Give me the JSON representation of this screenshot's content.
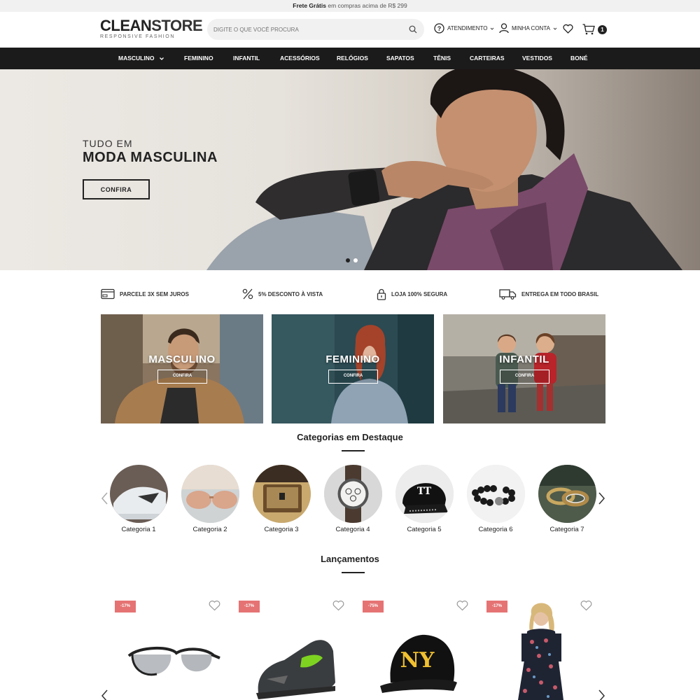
{
  "topbar": {
    "bold": "Frete Grátis",
    "rest": " em compras acima de R$ 299"
  },
  "header": {
    "logo_main_a": "CLEAN",
    "logo_main_b": "STORE",
    "logo_sub": "RESPONSIVE FASHION",
    "search_placeholder": "DIGITE O QUE VOCÊ PROCURA",
    "atendimento": "ATENDIMENTO",
    "minha_conta": "MINHA CONTA",
    "cart_count": "1"
  },
  "nav": {
    "items": [
      {
        "label": "MASCULINO"
      },
      {
        "label": "FEMININO"
      },
      {
        "label": "INFANTIL"
      },
      {
        "label": "ACESSÓRIOS"
      },
      {
        "label": "RELÓGIOS"
      },
      {
        "label": "SAPATOS"
      },
      {
        "label": "TÊNIS"
      },
      {
        "label": "CARTEIRAS"
      },
      {
        "label": "VESTIDOS"
      },
      {
        "label": "BONÉ"
      }
    ]
  },
  "hero": {
    "line1": "TUDO EM",
    "line2": "MODA MASCULINA",
    "button": "CONFIRA"
  },
  "features": [
    {
      "label": "PARCELE 3X SEM JUROS",
      "icon": "credit-card-icon"
    },
    {
      "label": "5% DESCONTO À VISTA",
      "icon": "percent-icon"
    },
    {
      "label": "LOJA 100% SEGURA",
      "icon": "lock-icon"
    },
    {
      "label": "ENTREGA EM TODO BRASIL",
      "icon": "truck-icon"
    }
  ],
  "banners": [
    {
      "title": "MASCULINO",
      "button": "CONFIRA"
    },
    {
      "title": "FEMININO",
      "button": "CONFIRA"
    },
    {
      "title": "INFANTIL",
      "button": "CONFIRA"
    }
  ],
  "categorias": {
    "title": "Categorias em Destaque",
    "items": [
      {
        "label": "Categoria 1"
      },
      {
        "label": "Categoria 2"
      },
      {
        "label": "Categoria 3"
      },
      {
        "label": "Categoria 4"
      },
      {
        "label": "Categoria 5"
      },
      {
        "label": "Categoria 6"
      },
      {
        "label": "Categoria 7"
      }
    ]
  },
  "lancamentos": {
    "title": "Lançamentos",
    "products": [
      {
        "discount": "-17%"
      },
      {
        "discount": "-17%"
      },
      {
        "discount": "-75%"
      },
      {
        "discount": "-17%"
      }
    ]
  }
}
